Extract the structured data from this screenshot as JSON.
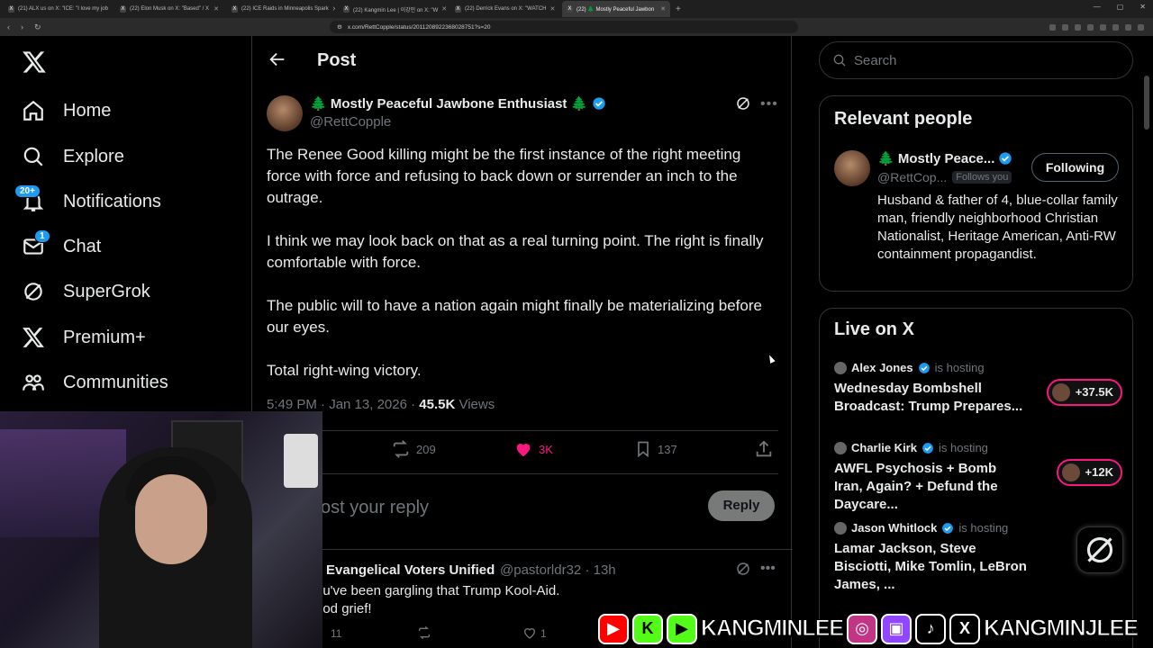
{
  "browser": {
    "tabs": [
      {
        "label": "(21) ALX us on X: \"ICE: \"I love my job"
      },
      {
        "label": "(22) Elon Musk on X: \"Based\" / X"
      },
      {
        "label": "(22) ICE Raids in Minneapolis Spark"
      },
      {
        "label": "(22) Kangmin Lee | 이강민 on X: \"W"
      },
      {
        "label": "(22) Derrick Evans on X: \"WATCH"
      },
      {
        "label": "(22) 🌲 Mostly Peaceful Jawbon",
        "active": true
      }
    ],
    "url": "x.com/RettCopple/status/2011208922368028751?s=20"
  },
  "nav": {
    "logo": "x-logo-icon",
    "items": [
      {
        "label": "Home",
        "icon": "home-icon"
      },
      {
        "label": "Explore",
        "icon": "search-icon"
      },
      {
        "label": "Notifications",
        "icon": "bell-icon",
        "badge": "20+"
      },
      {
        "label": "Chat",
        "icon": "mail-icon",
        "badge": "1"
      },
      {
        "label": "SuperGrok",
        "icon": "grok-icon"
      },
      {
        "label": "Premium+",
        "icon": "x-logo-icon"
      },
      {
        "label": "Communities",
        "icon": "communities-icon"
      }
    ]
  },
  "post": {
    "header_title": "Post",
    "author_name": "🌲 Mostly Peaceful Jawbone Enthusiast 🌲",
    "author_handle": "@RettCopple",
    "paragraphs": [
      "The Renee Good killing might be the first instance of the right meeting force with force and refusing to back down or surrender an inch to the outrage.",
      "I think we may look back on that as a real turning point. The right is finally comfortable with force.",
      "The public will to have a nation again might finally be materializing before our eyes.",
      "Total right-wing victory."
    ],
    "time": "5:49 PM · Jan 13, 2026 · ",
    "views_count": "45.5K",
    "views_label": " Views",
    "reposts": "209",
    "likes": "3K",
    "bookmarks": "137"
  },
  "reply": {
    "placeholder": "ost your reply",
    "button": "Reply"
  },
  "first_reply": {
    "name": "Evangelical Voters Unified",
    "handle": "@pastorldr32 · 13h",
    "text_line1": "ou've been gargling that Trump Kool-Aid.",
    "text_line2": "ood grief!",
    "replies": "11",
    "likes": "1"
  },
  "search": {
    "placeholder": "Search"
  },
  "relevant": {
    "title": "Relevant people",
    "name": "🌲 Mostly Peace...",
    "handle": "@RettCop...",
    "follows_you": "Follows you",
    "button": "Following",
    "bio": "Husband & father of 4, blue-collar family man, friendly neighborhood Christian Nationalist, Heritage American, Anti-RW containment propagandist."
  },
  "live": {
    "title": "Live on X",
    "hosting_label": "is hosting",
    "items": [
      {
        "host": "Alex Jones",
        "title": "Wednesday Bombshell Broadcast: Trump Prepares...",
        "count": "+37.5K"
      },
      {
        "host": "Charlie Kirk",
        "title": "AWFL Psychosis + Bomb Iran, Again? + Defund the Daycare...",
        "count": "+12K"
      },
      {
        "host": "Jason Whitlock",
        "title": "Lamar Jackson, Steve Bisciotti, Mike Tomlin, LeBron James, ...",
        "count": ""
      }
    ]
  },
  "banner": {
    "name1": "KANGMINLEE",
    "name2": "KANGMINJLEE"
  },
  "colors": {
    "accent": "#1d9bf0",
    "like": "#f91880",
    "bg": "#000000",
    "muted": "#71767b"
  }
}
